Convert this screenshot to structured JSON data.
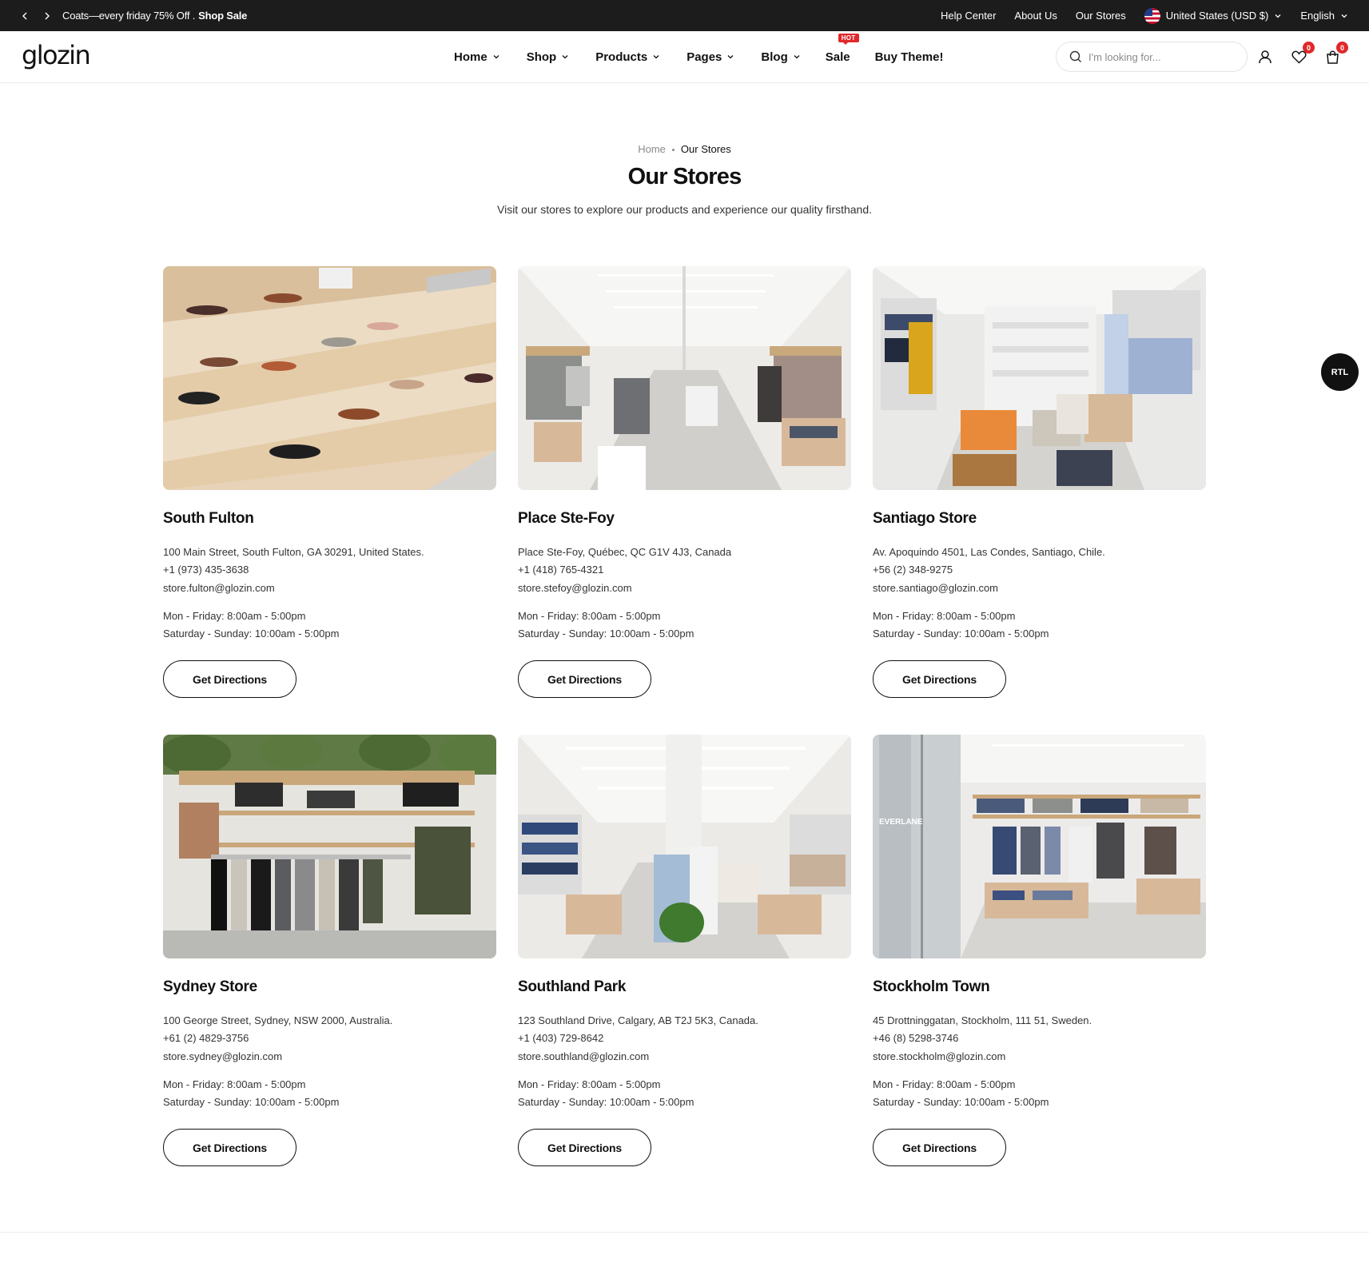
{
  "topbar": {
    "promo_text": "Coats—every friday 75% Off .",
    "promo_link": "Shop Sale",
    "links": [
      "Help Center",
      "About Us",
      "Our Stores"
    ],
    "country": "United States (USD $)",
    "language": "English"
  },
  "header": {
    "logo": "glozin",
    "nav": [
      "Home",
      "Shop",
      "Products",
      "Pages",
      "Blog",
      "Sale",
      "Buy Theme!"
    ],
    "hot_badge": "HOT",
    "search_placeholder": "I'm looking for...",
    "wishlist_count": "0",
    "cart_count": "0"
  },
  "breadcrumb": {
    "home": "Home",
    "current": "Our Stores"
  },
  "page": {
    "title": "Our Stores",
    "subtitle": "Visit our stores to explore our products and experience our quality firsthand."
  },
  "stores": [
    {
      "name": "South Fulton",
      "address": "100 Main Street, South Fulton, GA 30291, United States.",
      "phone": "+1 (973) 435-3638",
      "email": "store.fulton@glozin.com",
      "hours_weekday": "Mon - Friday: 8:00am - 5:00pm",
      "hours_weekend": "Saturday - Sunday: 10:00am - 5:00pm",
      "button": "Get Directions"
    },
    {
      "name": "Place Ste-Foy",
      "address": "Place Ste-Foy, Québec, QC G1V 4J3, Canada",
      "phone": "+1 (418) 765-4321",
      "email": "store.stefoy@glozin.com",
      "hours_weekday": "Mon - Friday: 8:00am - 5:00pm",
      "hours_weekend": "Saturday - Sunday: 10:00am - 5:00pm",
      "button": "Get Directions"
    },
    {
      "name": "Santiago Store",
      "address": "Av. Apoquindo 4501, Las Condes, Santiago, Chile.",
      "phone": "+56 (2) 348-9275",
      "email": "store.santiago@glozin.com",
      "hours_weekday": "Mon - Friday: 8:00am - 5:00pm",
      "hours_weekend": "Saturday - Sunday: 10:00am - 5:00pm",
      "button": "Get Directions"
    },
    {
      "name": "Sydney Store",
      "address": "100 George Street, Sydney, NSW 2000, Australia.",
      "phone": "+61 (2) 4829-3756",
      "email": "store.sydney@glozin.com",
      "hours_weekday": "Mon - Friday: 8:00am - 5:00pm",
      "hours_weekend": "Saturday - Sunday: 10:00am - 5:00pm",
      "button": "Get Directions"
    },
    {
      "name": "Southland Park",
      "address": "123 Southland Drive, Calgary, AB T2J 5K3, Canada.",
      "phone": "+1 (403) 729-8642",
      "email": "store.southland@glozin.com",
      "hours_weekday": "Mon - Friday: 8:00am - 5:00pm",
      "hours_weekend": "Saturday - Sunday: 10:00am - 5:00pm",
      "button": "Get Directions"
    },
    {
      "name": "Stockholm Town",
      "address": "45 Drottninggatan, Stockholm, 111 51, Sweden.",
      "phone": "+46 (8) 5298-3746",
      "email": "store.stockholm@glozin.com",
      "hours_weekday": "Mon - Friday: 8:00am - 5:00pm",
      "hours_weekend": "Saturday - Sunday: 10:00am - 5:00pm",
      "button": "Get Directions"
    }
  ],
  "store_photo_labels": {
    "stockholm_window_text": "EVERLANE"
  },
  "rtl_button": "RTL",
  "colors": {
    "topbar_bg": "#1c1c1c",
    "accent_red": "#e0282b",
    "text": "#111111"
  }
}
